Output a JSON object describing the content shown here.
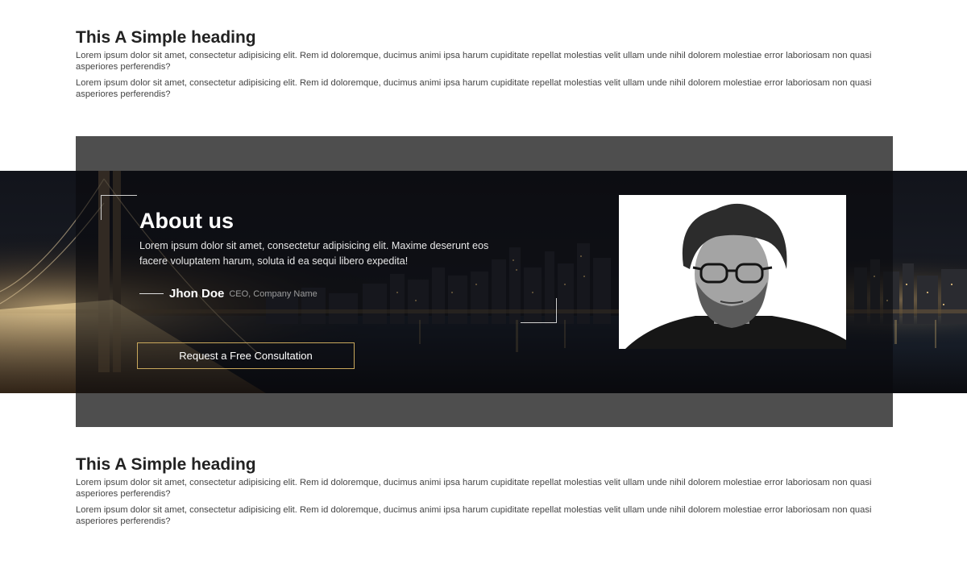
{
  "top_section": {
    "heading": "This A Simple heading",
    "paragraph1": "Lorem ipsum dolor sit amet, consectetur adipisicing elit. Rem id doloremque, ducimus animi ipsa harum cupiditate repellat molestias velit ullam unde nihil dolorem molestiae error laboriosam non quasi asperiores perferendis?",
    "paragraph2": "Lorem ipsum dolor sit amet, consectetur adipisicing elit. Rem id doloremque, ducimus animi ipsa harum cupiditate repellat molestias velit ullam unde nihil dolorem molestiae error laboriosam non quasi asperiores perferendis?"
  },
  "about": {
    "title": "About us",
    "text": "Lorem ipsum dolor sit amet, consectetur adipisicing elit. Maxime deserunt eos facere voluptatem harum, soluta id ea sequi libero expedita!",
    "author_name": "Jhon Doe",
    "author_role": "CEO, Company Name",
    "cta_label": "Request a Free Consultation",
    "accent_color": "#c9a85c",
    "background_image": "city-bridge-night-icon",
    "portrait_image": "person-portrait-icon"
  },
  "bottom_section": {
    "heading": "This A Simple heading",
    "paragraph1": "Lorem ipsum dolor sit amet, consectetur adipisicing elit. Rem id doloremque, ducimus animi ipsa harum cupiditate repellat molestias velit ullam unde nihil dolorem molestiae error laboriosam non quasi asperiores perferendis?",
    "paragraph2": "Lorem ipsum dolor sit amet, consectetur adipisicing elit. Rem id doloremque, ducimus animi ipsa harum cupiditate repellat molestias velit ullam unde nihil dolorem molestiae error laboriosam non quasi asperiores perferendis?"
  }
}
